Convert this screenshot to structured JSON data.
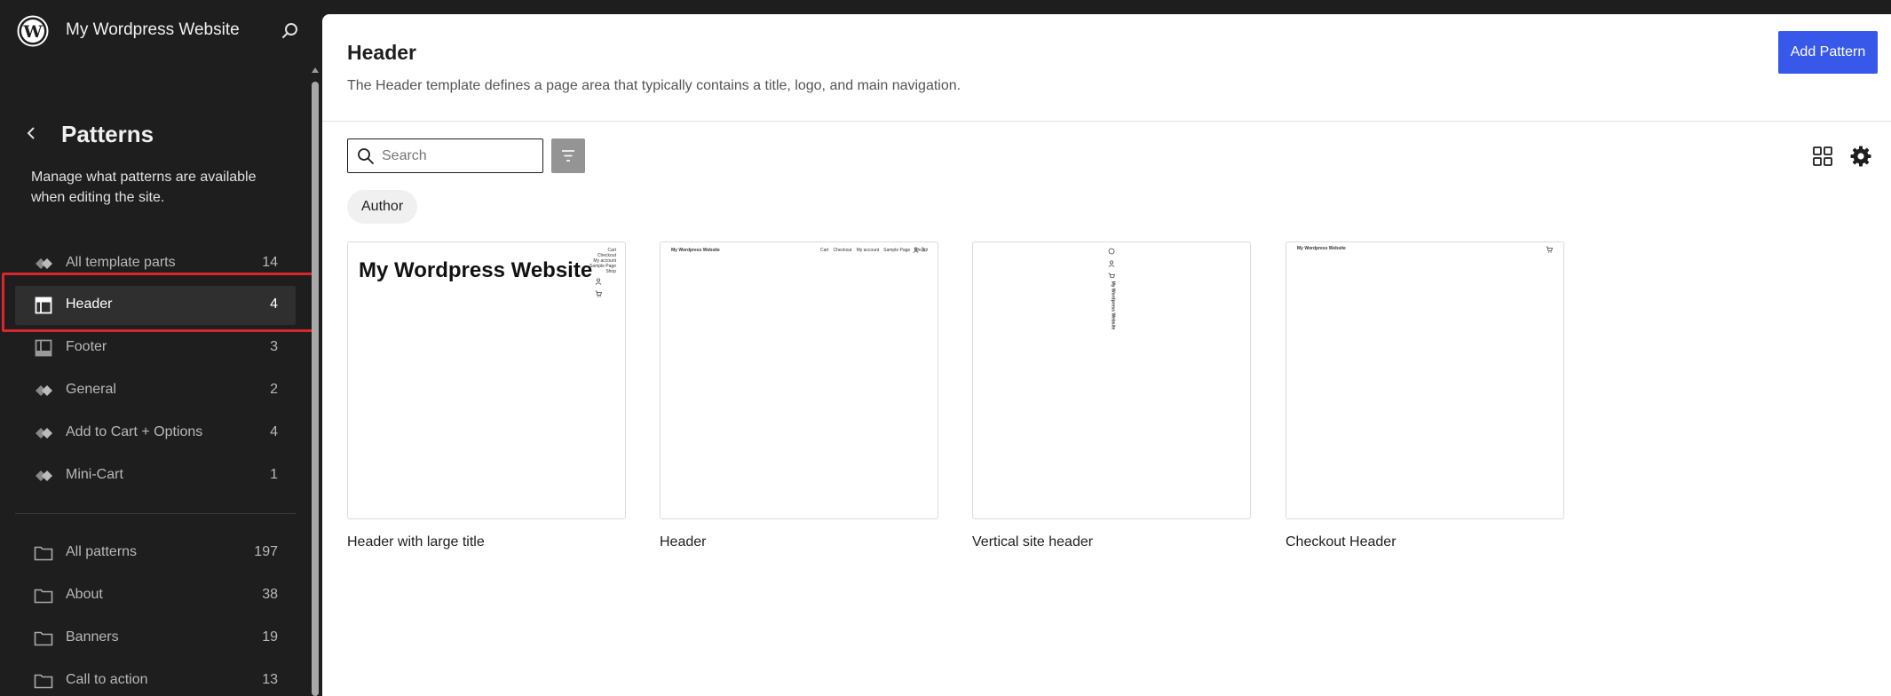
{
  "site": {
    "title": "My Wordpress Website"
  },
  "sidebar": {
    "title": "Patterns",
    "description": "Manage what patterns are available when editing the site.",
    "template_parts": [
      {
        "label": "All template parts",
        "count": "14",
        "icon": "diamond-pattern-icon"
      },
      {
        "label": "Header",
        "count": "4",
        "icon": "header-layout-icon",
        "active": true
      },
      {
        "label": "Footer",
        "count": "3",
        "icon": "footer-layout-icon"
      },
      {
        "label": "General",
        "count": "2",
        "icon": "diamond-pattern-icon"
      },
      {
        "label": "Add to Cart + Options",
        "count": "4",
        "icon": "diamond-pattern-icon"
      },
      {
        "label": "Mini-Cart",
        "count": "1",
        "icon": "diamond-pattern-icon"
      }
    ],
    "categories": [
      {
        "label": "All patterns",
        "count": "197",
        "icon": "folder-icon"
      },
      {
        "label": "About",
        "count": "38",
        "icon": "folder-icon"
      },
      {
        "label": "Banners",
        "count": "19",
        "icon": "folder-icon"
      },
      {
        "label": "Call to action",
        "count": "13",
        "icon": "folder-icon"
      }
    ]
  },
  "main": {
    "title": "Header",
    "description": "The Header template defines a page area that typically contains a title, logo, and main navigation.",
    "add_button": "Add Pattern",
    "search_placeholder": "Search",
    "author_filter": "Author",
    "patterns": [
      {
        "caption": "Header with large title",
        "preview_title": "My Wordpress Website",
        "preview_nav": [
          "Cart",
          "Checkout",
          "My account",
          "Sample Page",
          "Shop"
        ]
      },
      {
        "caption": "Header",
        "preview_title": "My Wordpress Website",
        "preview_nav": [
          "Cart",
          "Checkout",
          "My account",
          "Sample Page",
          "Shop"
        ]
      },
      {
        "caption": "Vertical site header",
        "preview_title": "My Wordpress Website"
      },
      {
        "caption": "Checkout Header",
        "preview_title": "My Wordpress Website"
      }
    ]
  },
  "colors": {
    "sidebar_bg": "#1e1e1e",
    "accent": "#3858e9",
    "highlight": "#d9262b"
  }
}
